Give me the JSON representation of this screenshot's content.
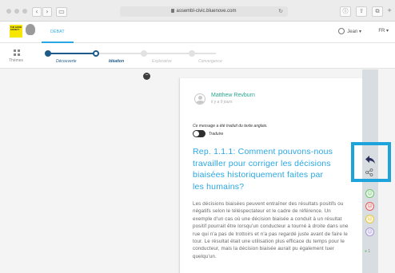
{
  "browser": {
    "url": "assembl-civic.bluenove.com",
    "back_label": "‹",
    "forward_label": "›",
    "sidebar_label": "▭",
    "reload_label": "↻",
    "info_label": "ⓘ",
    "share_label": "⇧",
    "tabs_label": "⧉",
    "add_label": "+"
  },
  "header": {
    "logo_text": "THE GOOD SOCIETY",
    "tab_label": "DÉBAT",
    "user_name": "Jean",
    "language": "FR"
  },
  "progress": {
    "themes_label": "Thèmes",
    "steps": [
      {
        "label": "Découverte",
        "state": "done"
      },
      {
        "label": "Idéation",
        "state": "current"
      },
      {
        "label": "Explorative",
        "state": "todo"
      },
      {
        "label": "Convergence",
        "state": "todo"
      }
    ]
  },
  "post": {
    "author": "Matthew Revburn",
    "time": "il y a 9 jours",
    "translated_note": "Ce message a été traduit du texte anglais.",
    "translate_toggle_label": "Traduire",
    "title": "Rep. 1.1.1: Comment pouvons-nous travailler pour corriger les décisions biaisées historiquement faites par les humains?",
    "body": "Les décisions biaisées peuvent entraîner des résultats positifs ou négatifs selon le téléspectateur et le cadre de référence. Un exemple d'un cas où une décision biaisée a conduit à un résultat positif pourrait être lorsqu'un conducteur a tourné à droite dans une rue qui n'a pas de trottoirs et n'a pas regardé juste avant de faire le tour. Le résultat était une utilisation plus efficace du temps pour le conducteur, mais la décision biaisée aurait pu également tuer quelqu'un."
  },
  "rail": {
    "collapse_label": "−",
    "sentiments": [
      {
        "name": "like",
        "glyph": "☺",
        "color": "#6cc56c"
      },
      {
        "name": "disagree",
        "glyph": "☹",
        "color": "#e8575d"
      },
      {
        "name": "dont-understand",
        "glyph": "☹",
        "color": "#e7c83a"
      },
      {
        "name": "more-info",
        "glyph": "☺",
        "color": "#a79ad6"
      }
    ],
    "sentiment_count": "1"
  },
  "colors": {
    "accent": "#29a7e4",
    "author": "#2aa68f",
    "highlight": "#1ea4dc"
  }
}
